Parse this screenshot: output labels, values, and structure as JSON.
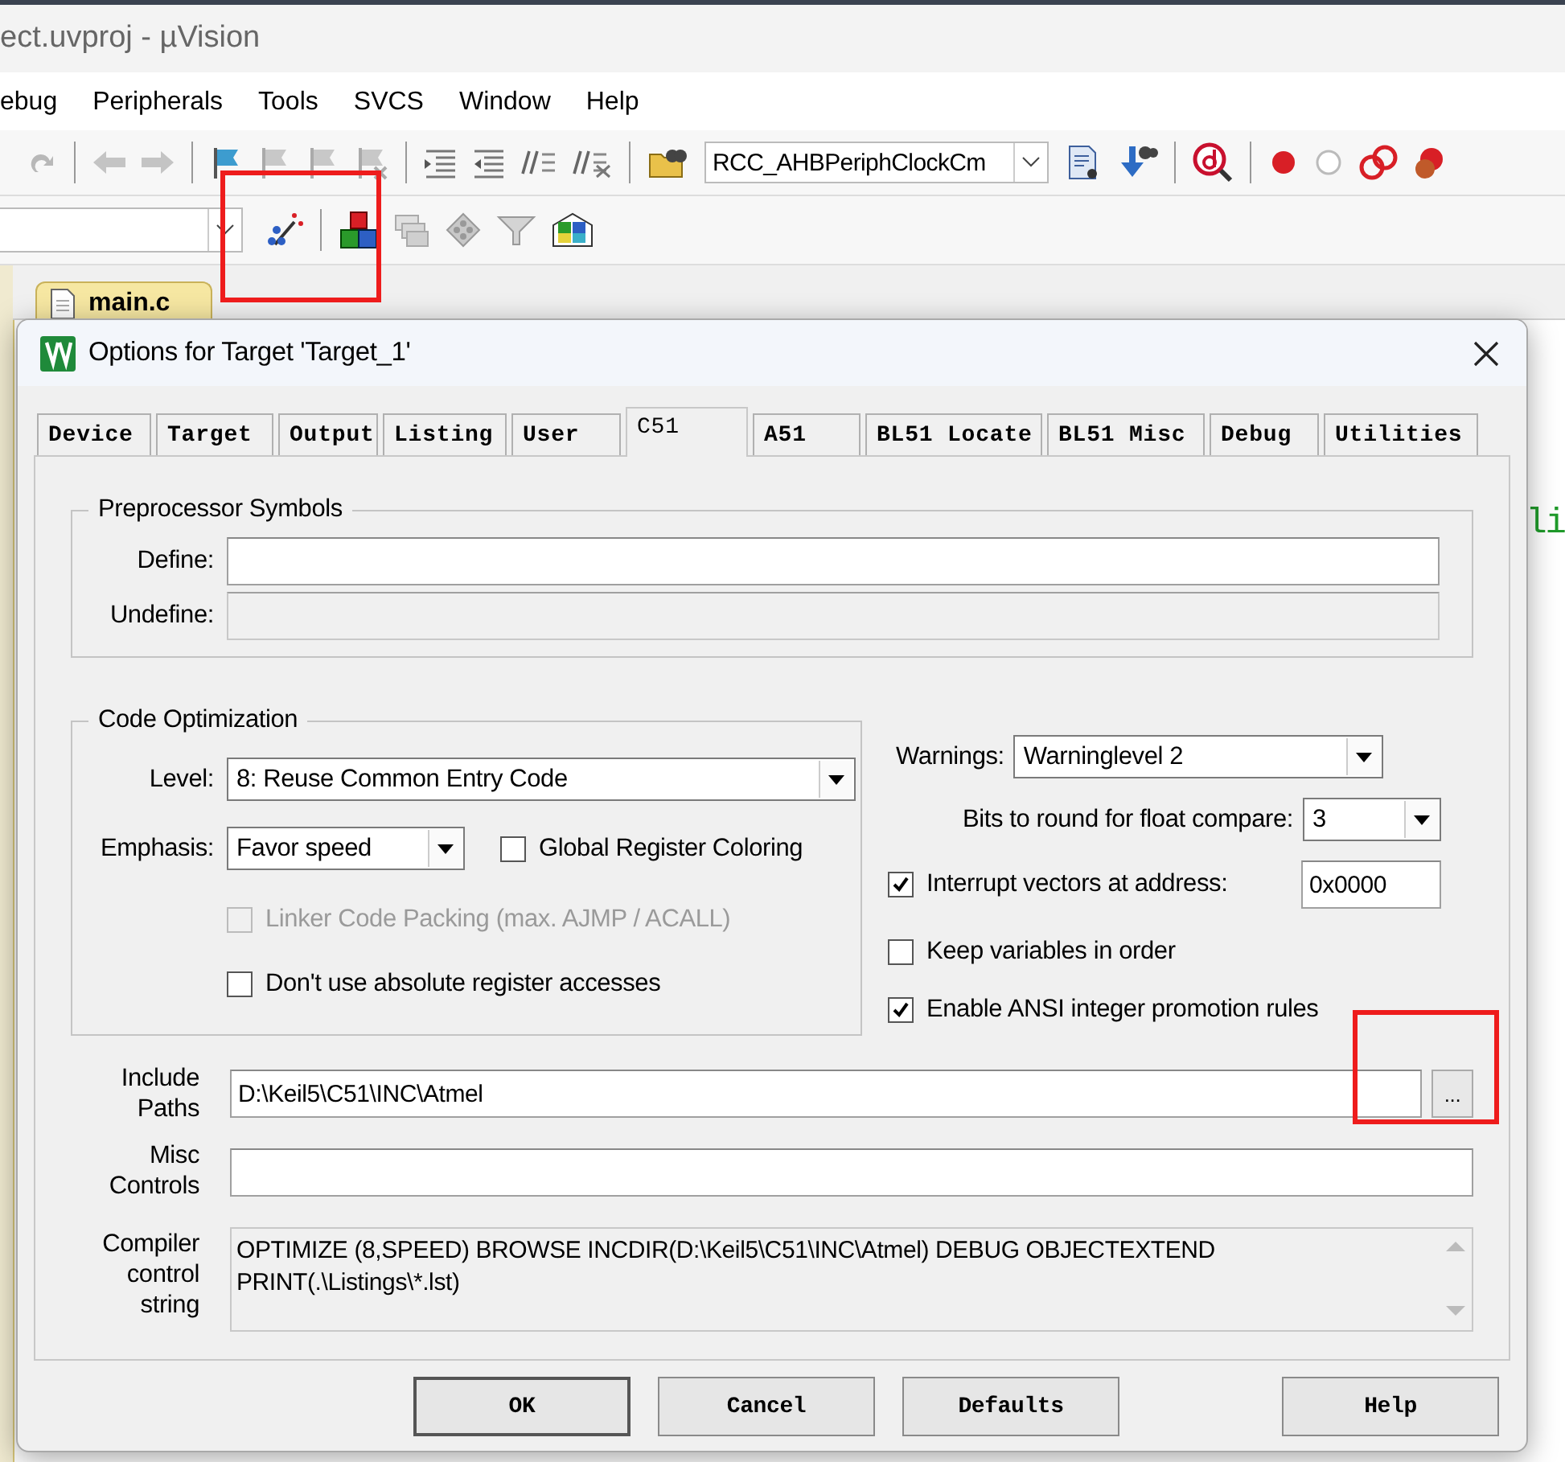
{
  "app": {
    "title": "ect.uvproj - µVision",
    "menu": [
      "ebug",
      "Peripherals",
      "Tools",
      "SVCS",
      "Window",
      "Help"
    ],
    "find_combo": "RCC_AHBPeriphClockCm",
    "options_buttons_highlighted": true,
    "editor_tab": "main.c",
    "editor_text": "li"
  },
  "dialog": {
    "title": "Options for Target 'Target_1'",
    "tabs": [
      {
        "label": "Device",
        "selected": false
      },
      {
        "label": "Target",
        "selected": false
      },
      {
        "label": "Output",
        "selected": false
      },
      {
        "label": "Listing",
        "selected": false
      },
      {
        "label": "User",
        "selected": false
      },
      {
        "label": "C51",
        "selected": true
      },
      {
        "label": "A51",
        "selected": false
      },
      {
        "label": "BL51 Locate",
        "selected": false
      },
      {
        "label": "BL51 Misc",
        "selected": false
      },
      {
        "label": "Debug",
        "selected": false
      },
      {
        "label": "Utilities",
        "selected": false
      }
    ],
    "preprocessor": {
      "title": "Preprocessor Symbols",
      "fields": [
        {
          "label": "Define:",
          "disabled": false
        },
        {
          "label": "Undefine:",
          "disabled": true
        }
      ]
    },
    "code_optimization": {
      "title": "Code Optimization",
      "level": {
        "label": "Level:",
        "value": "8: Reuse Common Entry Code"
      },
      "emphasis": {
        "label": "Emphasis:",
        "value": "Favor speed"
      },
      "options": [
        {
          "label": "Global Register Coloring",
          "checked": false,
          "disabled": false
        },
        {
          "label": "Linker Code Packing (max. AJMP / ACALL)",
          "checked": false,
          "disabled": true
        },
        {
          "label": "Don't use absolute register accesses",
          "checked": false,
          "disabled": false
        }
      ]
    },
    "warnings": {
      "label": "Warnings:",
      "value": "Warninglevel 2"
    },
    "float_bits": {
      "label": "Bits to round for float compare:",
      "value": "3"
    },
    "interrupt_vectors": {
      "label": "Interrupt vectors at address:",
      "checked": true,
      "value": "0x0000"
    },
    "right_options": [
      {
        "label": "Keep variables in order",
        "checked": false
      },
      {
        "label": "Enable ANSI integer promotion rules",
        "checked": true
      }
    ],
    "include_paths": {
      "label": "Include Paths",
      "value": "D:\\Keil5\\C51\\INC\\Atmel",
      "browse": "...",
      "browse_highlighted": true
    },
    "misc_controls": {
      "label": "Misc Controls"
    },
    "compiler_string": {
      "label": "Compiler control string",
      "value": "OPTIMIZE (8,SPEED) BROWSE INCDIR(D:\\Keil5\\C51\\INC\\Atmel) DEBUG OBJECTEXTEND PRINT(.\\Listings\\*.lst)"
    },
    "buttons": [
      "OK",
      "Cancel",
      "Defaults",
      "Help"
    ]
  }
}
